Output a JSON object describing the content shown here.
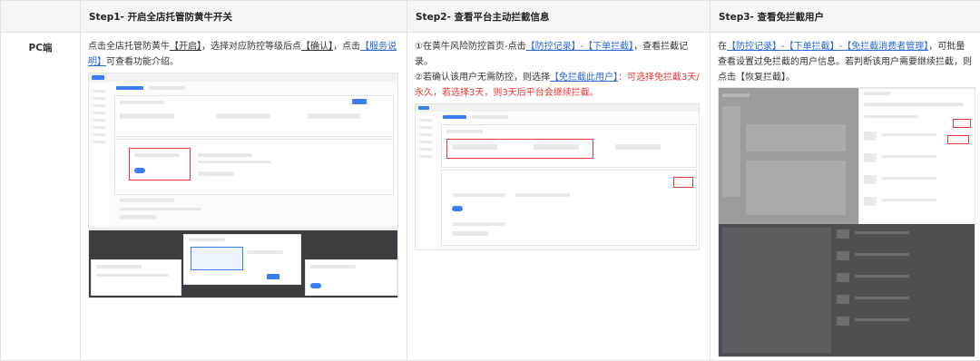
{
  "headers": {
    "platform": "",
    "step1": "Step1- 开启全店托管防黄牛开关",
    "step2": "Step2- 查看平台主动拦截信息",
    "step3": "Step3- 查看免拦截用户"
  },
  "row": {
    "label": "PC端",
    "step1": {
      "t1": "点击全店托管防黄牛",
      "t2": "【开启】",
      "t3": "，选择对应防控等级后点",
      "t4": "【确认】",
      "t5": "，点击",
      "t6": "【服务说明】",
      "t7": "可查看功能介绍。"
    },
    "step2": {
      "a1": "①在黄牛风险防控首页-点击",
      "a2": "【防控记录】-【下单拦截】",
      "a3": "，查看拦截记录。",
      "b1": "②若确认该用户无需防控，则选择",
      "b2": "【免拦截此用户】",
      "b3": "：可选择免拦截3天/永久，若选择3天，则3天后平台会继续拦截。"
    },
    "step3": {
      "c1": "在",
      "c2": "【防控记录】-【下单拦截】-【免拦截消费者管理】",
      "c3": "，可批量查看设置过免拦截的用户信息。若判断该用户需要继续拦截，则点击【恢复拦截】。"
    }
  }
}
